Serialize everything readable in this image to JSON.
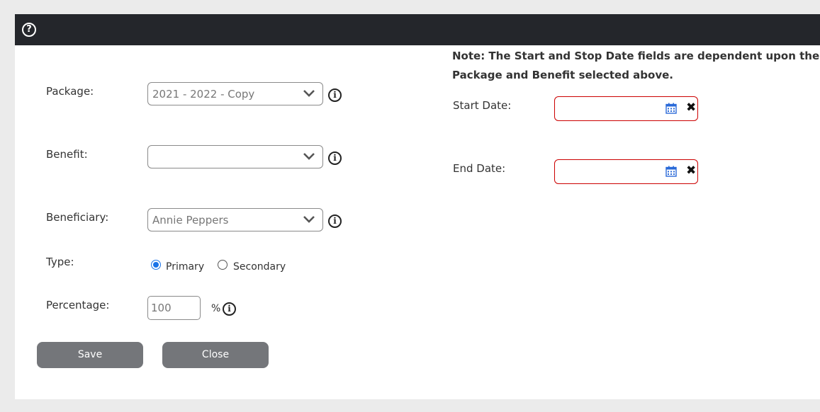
{
  "dialog": {
    "help_icon": "?"
  },
  "form": {
    "package": {
      "label": "Package:",
      "value": "2021 - 2022 - Copy"
    },
    "benefit": {
      "label": "Benefit:",
      "value": ""
    },
    "beneficiary": {
      "label": "Beneficiary:",
      "value": "Annie Peppers"
    },
    "type": {
      "label": "Type:",
      "options": [
        {
          "label": "Primary",
          "checked": true
        },
        {
          "label": "Secondary",
          "checked": false
        }
      ]
    },
    "percentage": {
      "label": "Percentage:",
      "value": "100",
      "unit": "%"
    },
    "info_glyph": "i"
  },
  "buttons": {
    "save": "Save",
    "close": "Close"
  },
  "dates": {
    "note": "Note: The Start and Stop Date fields are dependent upon the Package and Benefit selected above.",
    "start": {
      "label": "Start Date:",
      "value": ""
    },
    "end": {
      "label": "End Date:",
      "value": ""
    },
    "clear_glyph": "✖"
  },
  "colors": {
    "titlebar": "#24262b",
    "button": "#74767a",
    "error_border": "#cc0000",
    "radio_accent": "#1a73e8",
    "calendar_icon": "#2a6ad8"
  }
}
